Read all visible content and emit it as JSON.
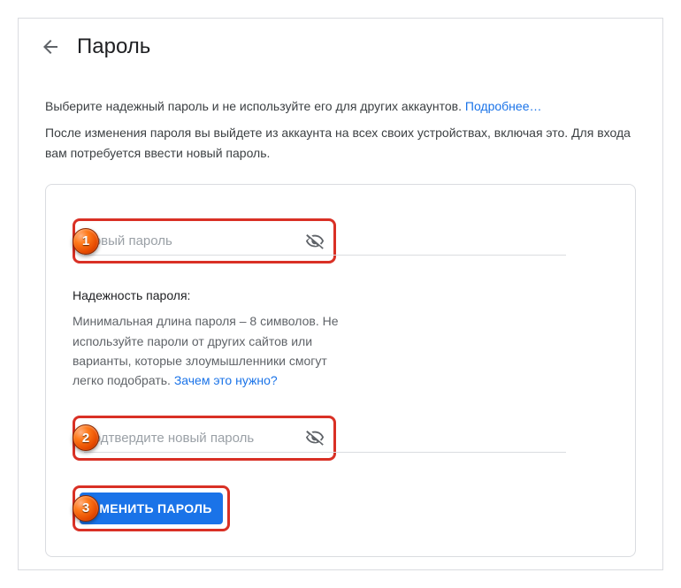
{
  "header": {
    "title": "Пароль"
  },
  "description": {
    "line1": "Выберите надежный пароль и не используйте его для других аккаунтов. ",
    "learn_more": "Подробнее…",
    "line2": "После изменения пароля вы выйдете из аккаунта на всех своих устройствах, включая это. Для входа вам потребуется ввести новый пароль."
  },
  "form": {
    "new_password_placeholder": "Новый пароль",
    "confirm_password_placeholder": "Подтвердите новый пароль",
    "submit_label": "СМЕНИТЬ ПАРОЛЬ"
  },
  "strength": {
    "title": "Надежность пароля:",
    "text": "Минимальная длина пароля – 8 символов. Не используйте пароли от других сайтов или варианты, которые злоумышленники смогут легко подобрать. ",
    "why_link": "Зачем это нужно?"
  },
  "callouts": {
    "c1": "1",
    "c2": "2",
    "c3": "3"
  }
}
